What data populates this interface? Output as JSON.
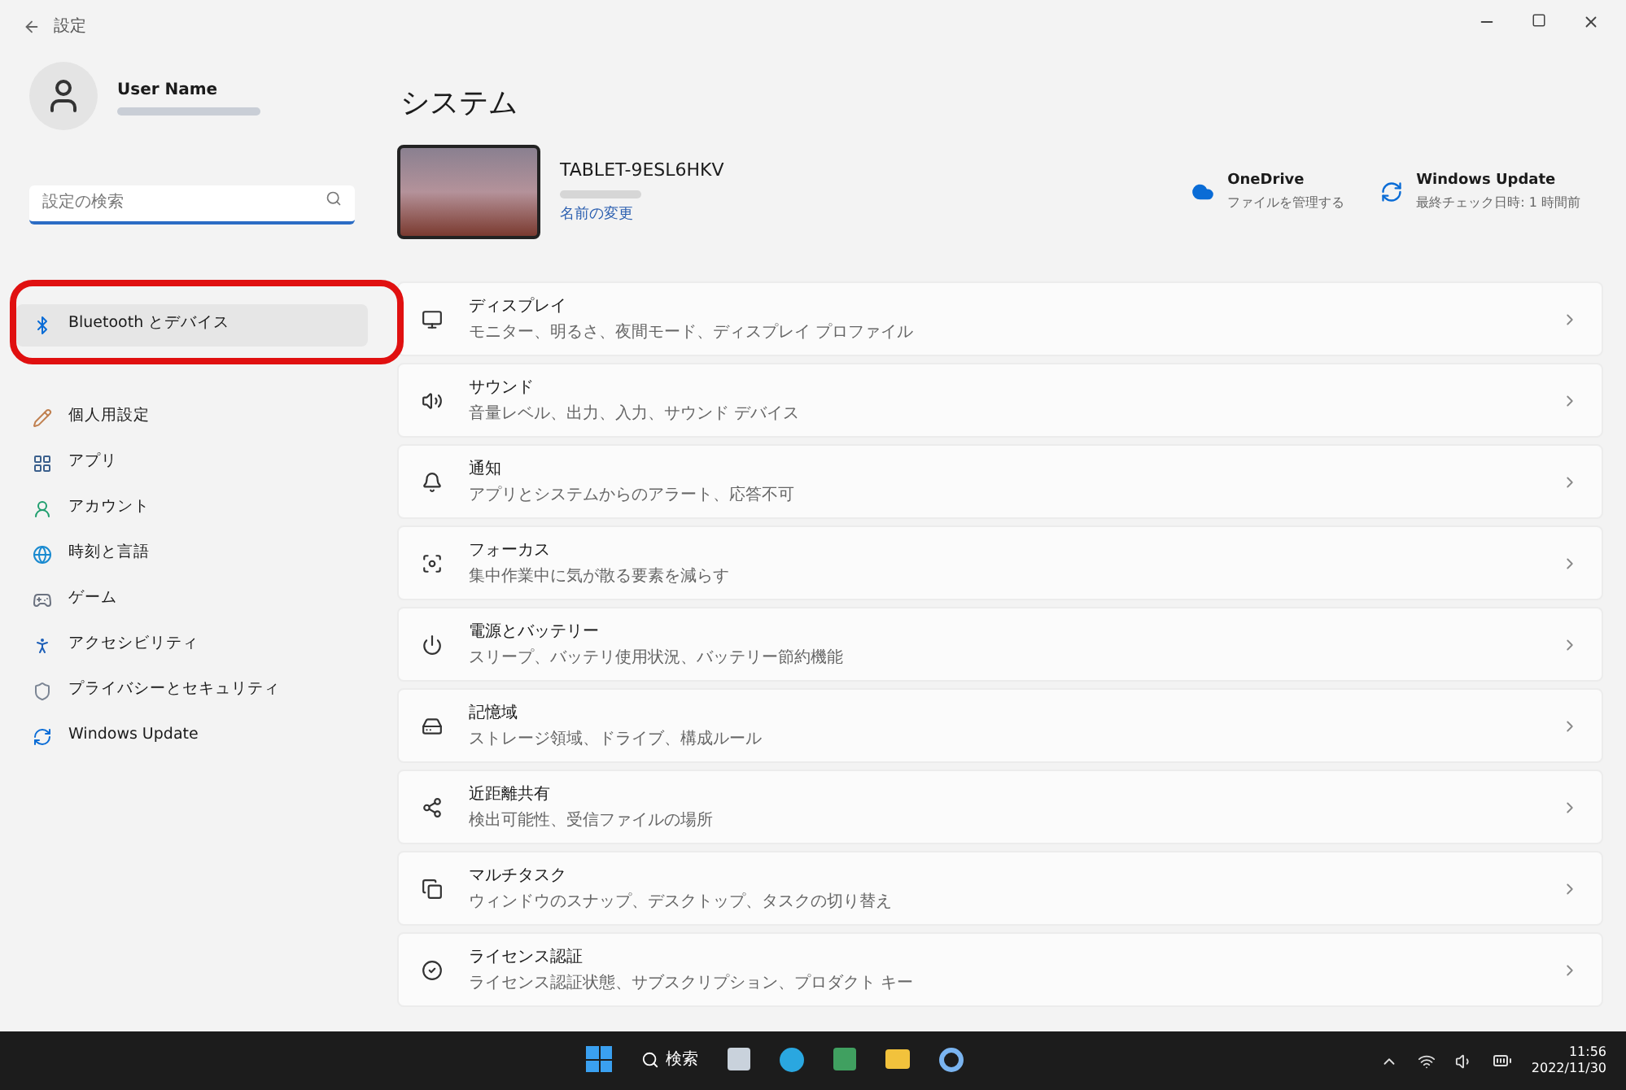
{
  "window": {
    "title": "設定"
  },
  "user": {
    "name": "User Name"
  },
  "search": {
    "placeholder": "設定の検索"
  },
  "sidebar": {
    "items": [
      {
        "kind": "bluetooth",
        "label": "Bluetooth とデバイス",
        "selected": true
      },
      {
        "kind": "personalize",
        "label": "個人用設定",
        "selected": false
      },
      {
        "kind": "apps",
        "label": "アプリ",
        "selected": false
      },
      {
        "kind": "account",
        "label": "アカウント",
        "selected": false
      },
      {
        "kind": "time",
        "label": "時刻と言語",
        "selected": false
      },
      {
        "kind": "gaming",
        "label": "ゲーム",
        "selected": false
      },
      {
        "kind": "accessibility",
        "label": "アクセシビリティ",
        "selected": false
      },
      {
        "kind": "privacy",
        "label": "プライバシーとセキュリティ",
        "selected": false
      },
      {
        "kind": "update",
        "label": "Windows Update",
        "selected": false
      }
    ]
  },
  "page": {
    "title": "システム",
    "device": {
      "name": "TABLET-9ESL6HKV",
      "rename_link": "名前の変更"
    },
    "quick": [
      {
        "kind": "cloud",
        "title": "OneDrive",
        "subtitle": "ファイルを管理する"
      },
      {
        "kind": "update",
        "title": "Windows Update",
        "subtitle": "最終チェック日時: 1 時間前"
      }
    ],
    "items": [
      {
        "kind": "display",
        "title": "ディスプレイ",
        "subtitle": "モニター、明るさ、夜間モード、ディスプレイ プロファイル"
      },
      {
        "kind": "sound",
        "title": "サウンド",
        "subtitle": "音量レベル、出力、入力、サウンド デバイス"
      },
      {
        "kind": "notify",
        "title": "通知",
        "subtitle": "アプリとシステムからのアラート、応答不可"
      },
      {
        "kind": "focus",
        "title": "フォーカス",
        "subtitle": "集中作業中に気が散る要素を減らす"
      },
      {
        "kind": "power",
        "title": "電源とバッテリー",
        "subtitle": "スリープ、バッテリ使用状況、バッテリー節約機能"
      },
      {
        "kind": "storage",
        "title": "記憶域",
        "subtitle": "ストレージ領域、ドライブ、構成ルール"
      },
      {
        "kind": "share",
        "title": "近距離共有",
        "subtitle": "検出可能性、受信ファイルの場所"
      },
      {
        "kind": "multitask",
        "title": "マルチタスク",
        "subtitle": "ウィンドウのスナップ、デスクトップ、タスクの切り替え"
      },
      {
        "kind": "license",
        "title": "ライセンス認証",
        "subtitle": "ライセンス認証状態、サブスクリプション、プロダクト キー"
      }
    ]
  },
  "taskbar": {
    "search_label": "検索",
    "time": "11:56",
    "date": "2022/11/30"
  }
}
